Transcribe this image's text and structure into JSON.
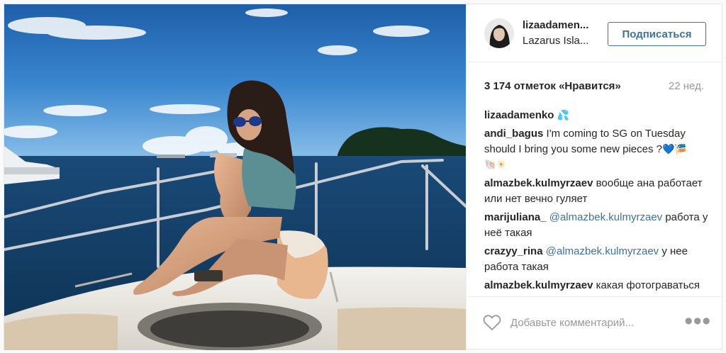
{
  "post": {
    "image_alt": "Woman in sunglasses sitting on the bow of a yacht, sea and island in the background",
    "owner": {
      "username": "lizaadamen...",
      "location": "Lazarus Isla..."
    },
    "follow_label": "Подписаться",
    "likes_text": "3 174 отметок «Нравится»",
    "time_ago": "22 нед.",
    "caption": {
      "username": "lizaadamenko",
      "emoji": "💦"
    },
    "comments": [
      {
        "username": "andi_bagus",
        "text": "I'm coming to SG on Tuesday should I bring you some new pieces ?",
        "emoji_blue": "💙",
        "emoji_fish": "🎏",
        "emoji_shell": "🐚",
        "emoji_sun": "☀"
      },
      {
        "username": "almazbek.kulmyrzaev",
        "text": "вообще ана работает или нет вечно гуляет"
      },
      {
        "username": "marijuliana_",
        "mention": "@almazbek.kulmyrzaev",
        "text": "работа у неё такая"
      },
      {
        "username": "crazyy_rina",
        "mention": "@almazbek.kulmyrzaev",
        "text": "у нее работа такая"
      },
      {
        "username": "almazbek.kulmyrzaev",
        "text": "какая фотограваться что-ли"
      }
    ],
    "comment_placeholder": "Добавьте комментарий...",
    "icons": {
      "like": "heart-icon",
      "more": "more-options-icon"
    },
    "more_glyph": "●●●"
  }
}
